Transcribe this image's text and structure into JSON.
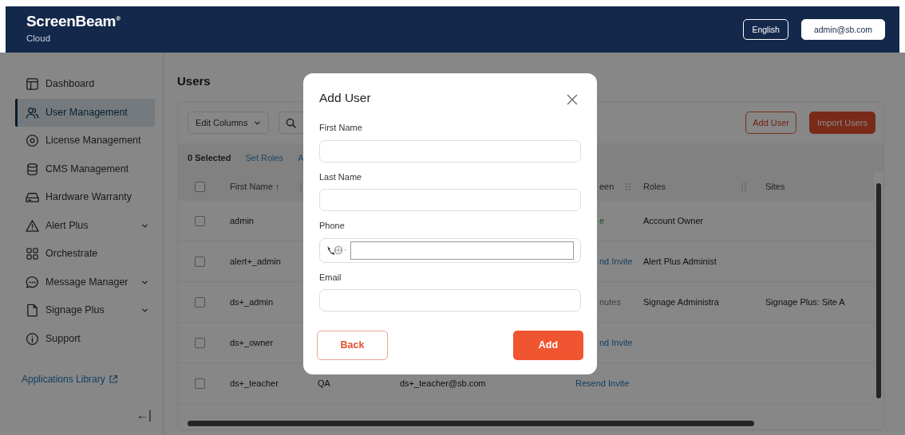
{
  "header": {
    "logo": "ScreenBeam",
    "logo_mark": "®",
    "subtitle": "Cloud",
    "language": "English",
    "account": "admin@sb.com"
  },
  "sidebar": {
    "items": [
      {
        "label": "Dashboard",
        "kind": "dashboard",
        "selected": false,
        "has_submenu": false
      },
      {
        "label": "User Management",
        "kind": "users",
        "selected": true,
        "has_submenu": false
      },
      {
        "label": "License Management",
        "kind": "disc",
        "selected": false,
        "has_submenu": false
      },
      {
        "label": "CMS Management",
        "kind": "database",
        "selected": false,
        "has_submenu": false
      },
      {
        "label": "Hardware Warranty",
        "kind": "drive",
        "selected": false,
        "has_submenu": false
      },
      {
        "label": "Alert Plus",
        "kind": "warning",
        "selected": false,
        "has_submenu": true
      },
      {
        "label": "Orchestrate",
        "kind": "grid",
        "selected": false,
        "has_submenu": false
      },
      {
        "label": "Message Manager",
        "kind": "chat",
        "selected": false,
        "has_submenu": true
      },
      {
        "label": "Signage Plus",
        "kind": "file",
        "selected": false,
        "has_submenu": true
      },
      {
        "label": "Support",
        "kind": "info",
        "selected": false,
        "has_submenu": false
      }
    ],
    "library_link": "Applications Library",
    "collapse": "←|"
  },
  "page": {
    "title": "Users"
  },
  "toolbar": {
    "edit_columns": "Edit Columns",
    "add_user": "Add User",
    "import_users": "Import Users"
  },
  "bulk_bar": {
    "selected_count": "0 Selected",
    "actions": [
      "Set Roles",
      "A"
    ]
  },
  "table": {
    "header": {
      "checked": false,
      "first_name": "First Name ↑",
      "column_5": {
        "text": "een",
        "cut": true
      },
      "roles": "Roles",
      "sites": "Sites"
    },
    "rows": [
      {
        "checked": false,
        "first_name": "admin",
        "column_5": {
          "text": "e",
          "cut": true,
          "kind": "online"
        },
        "roles": "Account Owner"
      },
      {
        "checked": false,
        "first_name": "alert+_admin",
        "column_5": {
          "text": "nd Invite",
          "cut": true,
          "kind": "link"
        },
        "roles": "Alert Plus Administ"
      },
      {
        "checked": false,
        "first_name": "ds+_admin",
        "column_5": {
          "text": "nutes",
          "cut": true,
          "kind": "time"
        },
        "roles": "Signage Administra",
        "sites": "Signage Plus: Site A"
      },
      {
        "checked": false,
        "first_name": "ds+_owner",
        "column_5": {
          "text": "nd Invite",
          "cut": true,
          "kind": "link"
        }
      },
      {
        "checked": false,
        "first_name": "ds+_teacher",
        "column_3": "QA",
        "email": "ds+_teacher@sb.com",
        "column_5": {
          "text": "Resend Invite",
          "cut": false,
          "kind": "link"
        }
      }
    ]
  },
  "modal": {
    "title": "Add User",
    "fields": [
      {
        "label": "First Name",
        "kind": "text"
      },
      {
        "label": "Last Name",
        "kind": "text"
      },
      {
        "label": "Phone",
        "kind": "phone"
      },
      {
        "label": "Email",
        "kind": "text"
      }
    ],
    "back": "Back",
    "add": "Add"
  }
}
